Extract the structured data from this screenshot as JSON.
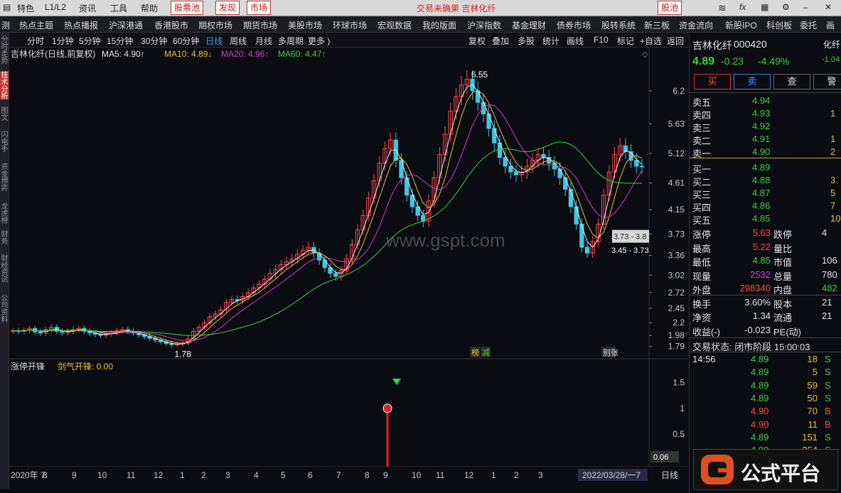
{
  "menubar": {
    "items": [
      "特色",
      "L1/L2",
      "资讯",
      "工具",
      "帮助"
    ],
    "tags": [
      "股票池",
      "发现",
      "市场"
    ],
    "center_text": "交易未确果 吉林化纤",
    "right_tag": "股池"
  },
  "navbar": [
    "测",
    "热点主题",
    "热点播报",
    "沪深港通",
    "香港股市",
    "期权市场",
    "期货市场",
    "美股市场",
    "环球市场",
    "宏观数据",
    "我的版面",
    "沪深指数",
    "基金理财",
    "债券市场",
    "股转系统",
    "新三板",
    "资金流向",
    "新股IPO",
    "科创板",
    "委托",
    "画"
  ],
  "leftstrip": [
    "分时走势",
    "技术分析",
    "图文",
    "",
    "闪电手",
    "",
    "资金博弈",
    "",
    "龙虎榜",
    "财务",
    "",
    "财经资讯",
    "",
    "公司资料"
  ],
  "periods": [
    "分时",
    "1分钟",
    "5分钟",
    "15分钟",
    "30分钟",
    "60分钟",
    "日线",
    "周线",
    "月线",
    "多周期",
    "更多 )"
  ],
  "toolbar": [
    "复权",
    "叠加",
    "多股",
    "统计",
    "画线",
    "F10",
    "标记",
    "+自选",
    "返回"
  ],
  "legend": {
    "title": "吉林化纤(日线,前复权)",
    "ma5": "MA5: 4.90↑",
    "ma10": "MA10: 4.89↓",
    "ma20": "MA20: 4.96↑",
    "ma60": "MA60: 4.47↑"
  },
  "chart_data": {
    "type": "candlestick",
    "title": "吉林化纤(日线,前复权)",
    "y_ticks": [
      6.2,
      5.63,
      5.12,
      4.61,
      4.15,
      3.73,
      3.36,
      3.02,
      2.72,
      2.45,
      2.2,
      1.98,
      1.79
    ],
    "ylim": [
      1.7,
      6.7
    ],
    "x_ticks": [
      "2020年 7",
      "8",
      "9",
      "10",
      "11",
      "12",
      "1",
      "2",
      "3",
      "4",
      "5",
      "6",
      "7",
      "8",
      "9",
      "10",
      "11",
      "12",
      "1",
      "2",
      "3",
      "2022/03/28/一7"
    ],
    "annotations": {
      "high": "6.55",
      "low": "1.78",
      "range_box": "3.73 - 3.8",
      "range_box2": "3.45 - 3.73"
    },
    "markers": [
      "榜",
      "减",
      "别张"
    ],
    "close_series": [
      2.06,
      2.05,
      2.07,
      2.1,
      2.04,
      2.02,
      2.08,
      2.12,
      2.05,
      2.03,
      2.05,
      2.08,
      2.1,
      2.05,
      2.02,
      2.0,
      1.98,
      2.01,
      2.03,
      2.06,
      2.08,
      2.05,
      2.02,
      1.99,
      1.96,
      1.93,
      1.9,
      1.87,
      1.84,
      1.82,
      1.83,
      1.85,
      1.92,
      2.05,
      2.12,
      2.2,
      2.3,
      2.35,
      2.42,
      2.55,
      2.6,
      2.58,
      2.65,
      2.72,
      2.8,
      2.86,
      2.95,
      3.05,
      3.12,
      3.2,
      3.25,
      3.3,
      3.38,
      3.45,
      3.5,
      3.4,
      3.28,
      3.15,
      3.05,
      3.0,
      3.1,
      3.3,
      3.55,
      3.8,
      4.05,
      4.35,
      4.65,
      4.95,
      5.2,
      5.35,
      5.0,
      4.7,
      4.4,
      4.2,
      4.05,
      3.95,
      4.3,
      4.7,
      5.1,
      5.45,
      5.85,
      6.1,
      6.3,
      6.4,
      6.2,
      6.0,
      5.8,
      5.55,
      5.3,
      5.05,
      4.9,
      4.8,
      4.75,
      4.8,
      4.9,
      5.0,
      5.1,
      5.05,
      4.95,
      4.85,
      4.7,
      4.5,
      4.2,
      3.9,
      3.5,
      3.4,
      3.6,
      3.9,
      4.4,
      4.8,
      5.1,
      5.25,
      5.15,
      5.0,
      4.9,
      4.89
    ],
    "indicator": {
      "name": "涨停开锋",
      "value_label": "剑气开锋: 0.00",
      "y_ticks": [
        1.5,
        1.0,
        0.5
      ],
      "current": "0.06",
      "signal_value": 1.0
    }
  },
  "stock": {
    "name": "吉林化纤",
    "code": "000420",
    "short": "化纤",
    "price": "4.89",
    "change": "-0.23",
    "pct": "-4.49%",
    "side_pct": "-1.04"
  },
  "buttons": [
    "买",
    "卖",
    "查",
    "警"
  ],
  "orderbook": [
    {
      "label": "卖五",
      "price": "4.94",
      "vol": ""
    },
    {
      "label": "卖四",
      "price": "4.93",
      "vol": "1"
    },
    {
      "label": "卖三",
      "price": "4.92",
      "vol": ""
    },
    {
      "label": "卖二",
      "price": "4.91",
      "vol": "1"
    },
    {
      "label": "卖一",
      "price": "4.90",
      "vol": "2"
    },
    {
      "label": "买一",
      "price": "4.89",
      "vol": ""
    },
    {
      "label": "买二",
      "price": "4.88",
      "vol": "3"
    },
    {
      "label": "买三",
      "price": "4.87",
      "vol": "5"
    },
    {
      "label": "买四",
      "price": "4.86",
      "vol": "7"
    },
    {
      "label": "买五",
      "price": "4.85",
      "vol": "10"
    }
  ],
  "stats": [
    {
      "k1": "涨停",
      "v1": "5.63",
      "k2": "跌停",
      "v2": "4"
    },
    {
      "k1": "最高",
      "v1": "5.22",
      "k2": "量比",
      "v2": ""
    },
    {
      "k1": "最低",
      "v1": "4.85",
      "k2": "市值",
      "v2": "106"
    },
    {
      "k1": "现量",
      "v1": "2532",
      "k2": "总量",
      "v2": "780"
    },
    {
      "k1": "外盘",
      "v1": "298340",
      "k2": "内盘",
      "v2": "482"
    },
    {
      "k1": "换手",
      "v1": "3.60%",
      "k2": "股本",
      "v2": "21"
    },
    {
      "k1": "净资",
      "v1": "1.34",
      "k2": "流通",
      "v2": "21"
    },
    {
      "k1": "收益(-)",
      "v1": "-0.023",
      "k2": "PE(动)",
      "v2": ""
    }
  ],
  "trade_status": "交易状态: 闭市阶段 15:00:03",
  "ticks": [
    {
      "time": "14:56",
      "price": "4.89",
      "vol": "18",
      "side": "S"
    },
    {
      "time": "",
      "price": "4.89",
      "vol": "5",
      "side": "S"
    },
    {
      "time": "",
      "price": "4.89",
      "vol": "59",
      "side": "S"
    },
    {
      "time": "",
      "price": "4.89",
      "vol": "50",
      "side": "S"
    },
    {
      "time": "",
      "price": "4.90",
      "vol": "70",
      "side": "B"
    },
    {
      "time": "",
      "price": "4.90",
      "vol": "11",
      "side": "B"
    },
    {
      "time": "",
      "price": "4.89",
      "vol": "151",
      "side": "S"
    },
    {
      "time": "",
      "price": "4.89",
      "vol": "354",
      "side": "S"
    }
  ],
  "watermark": "www.gspt.com",
  "logo_text": "公式平台",
  "bottom_right": "日线",
  "colors": {
    "up": "#ff4a4a",
    "down": "#3cd23c",
    "ma5": "#e8e8e8",
    "ma10": "#e8c23a",
    "ma20": "#d040d0",
    "ma60": "#3cd23c"
  }
}
